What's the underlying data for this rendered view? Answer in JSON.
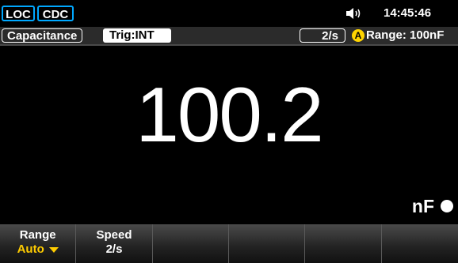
{
  "status": {
    "loc_label": "LOC",
    "cdc_label": "CDC",
    "speaker_icon": "speaker-icon",
    "time": "14:45:46"
  },
  "info": {
    "function": "Capacitance",
    "trigger": "Trig:INT",
    "rate": "2/s",
    "auto_badge": "A",
    "range": "Range: 100nF"
  },
  "reading": {
    "value": "100.2",
    "unit": "nF"
  },
  "softkeys": [
    {
      "label": "Range",
      "value": "Auto",
      "has_arrow": true
    },
    {
      "label": "Speed",
      "value": "2/s",
      "has_arrow": false
    },
    {
      "label": "",
      "value": ""
    },
    {
      "label": "",
      "value": ""
    },
    {
      "label": "",
      "value": ""
    },
    {
      "label": "",
      "value": ""
    }
  ],
  "colors": {
    "accent": "#00a8ff",
    "highlight": "#ffcc00",
    "auto_badge": "#ffd400"
  }
}
